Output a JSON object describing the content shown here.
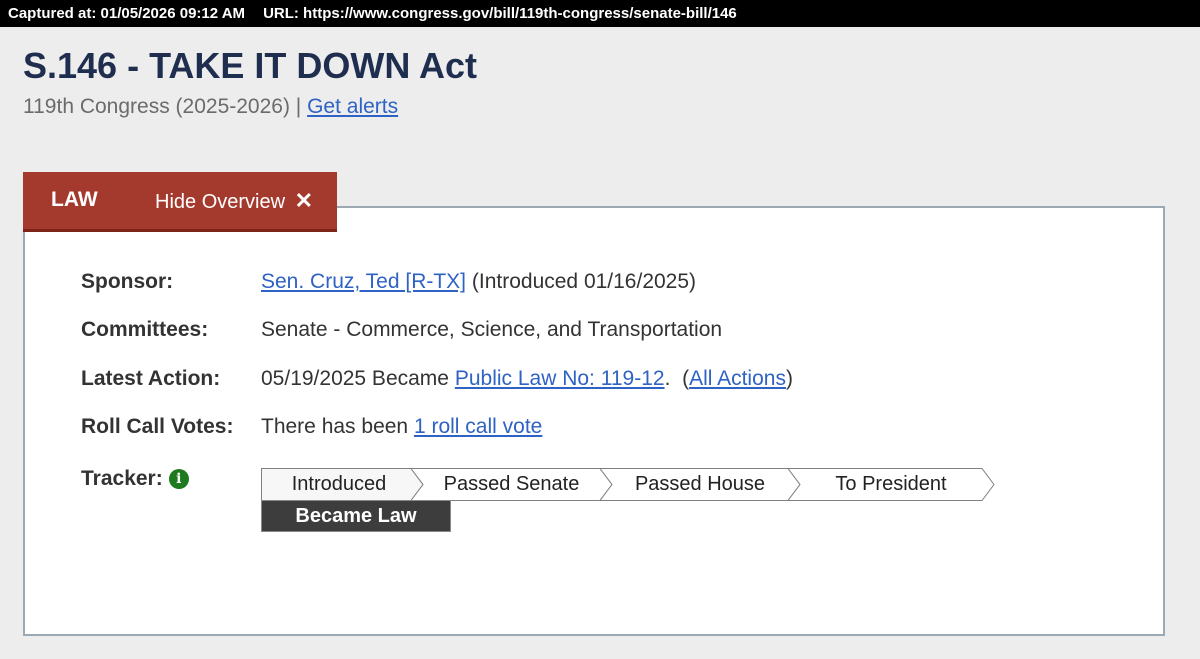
{
  "capture": {
    "captured_at": "Captured at: 01/05/2026 09:12 AM",
    "url": "URL: https://www.congress.gov/bill/119th-congress/senate-bill/146"
  },
  "bill": {
    "title": "S.146 - TAKE IT DOWN Act",
    "congress": "119th Congress (2025-2026) |",
    "alerts_link": "Get alerts"
  },
  "tab": {
    "status": "LAW",
    "hide_label": "Hide Overview",
    "close_glyph": "✕"
  },
  "overview": {
    "sponsor_label": "Sponsor:",
    "sponsor_link": "Sen. Cruz, Ted [R-TX]",
    "sponsor_suffix": "(Introduced 01/16/2025)",
    "committees_label": "Committees:",
    "committees_value": "Senate - Commerce, Science, and Transportation",
    "latest_action_label": "Latest Action:",
    "latest_action_prefix": "05/19/2025 Became",
    "latest_action_link": "Public Law No: 119-12",
    "latest_action_after": ".  (",
    "all_actions_link": "All Actions",
    "latest_action_close": ")",
    "roll_call_label": "Roll Call Votes:",
    "roll_call_prefix": "There has been",
    "roll_call_link": "1 roll call vote",
    "tracker_label": "Tracker:",
    "tracker_info_glyph": "i"
  },
  "tracker": {
    "stages": [
      "Introduced",
      "Passed Senate",
      "Passed House",
      "To President"
    ],
    "final_stage": "Became Law"
  },
  "colors": {
    "title": "#1f2e4f",
    "law_tab": "#a43a2d",
    "link": "#2e62c4",
    "info_icon": "#1d7a1d",
    "final_stage_bg": "#3d3d3d"
  }
}
